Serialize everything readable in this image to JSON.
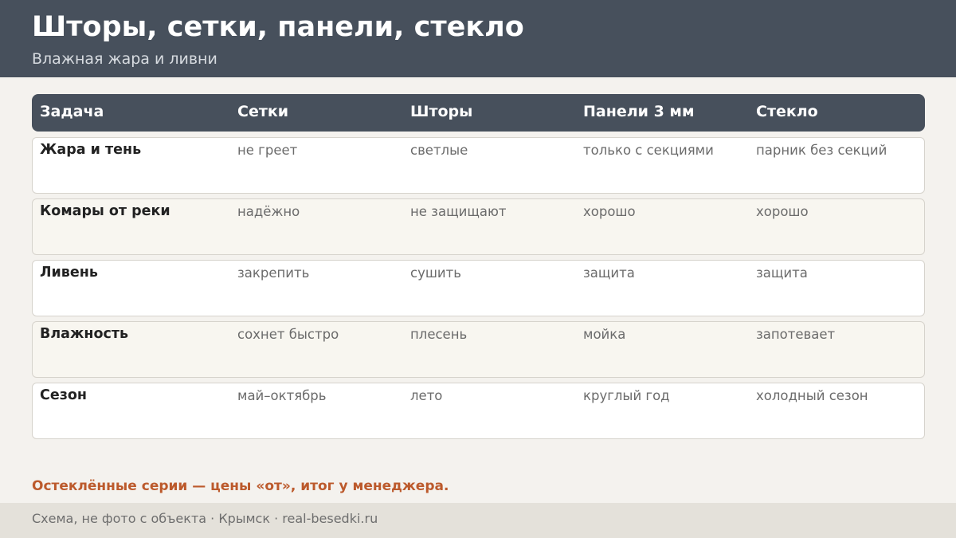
{
  "header": {
    "title": "Шторы, сетки, панели, стекло",
    "subtitle": "Влажная жара и ливни"
  },
  "table": {
    "columns": [
      "Задача",
      "Сетки",
      "Шторы",
      "Панели 3 мм",
      "Стекло"
    ],
    "rows": [
      [
        "Жара и тень",
        "не греет",
        "светлые",
        "только с секциями",
        "парник без секций"
      ],
      [
        "Комары от реки",
        "надёжно",
        "не защищают",
        "хорошо",
        "хорошо"
      ],
      [
        "Ливень",
        "закрепить",
        "сушить",
        "защита",
        "защита"
      ],
      [
        "Влажность",
        "сохнет быстро",
        "плесень",
        "мойка",
        "запотевает"
      ],
      [
        "Сезон",
        "май–октябрь",
        "лето",
        "круглый год",
        "холодный сезон"
      ]
    ]
  },
  "note": "Остеклённые серии — цены «от», итог у менеджера.",
  "footer": {
    "text": "Схема, не фото с объекта  ·  Крымск  ·  real-besedki.ru"
  },
  "colors": {
    "header_bg": "#47505c",
    "page_bg": "#f4f2ee",
    "accent": "#bc5a2c",
    "footer_bg": "#e4e1da"
  }
}
